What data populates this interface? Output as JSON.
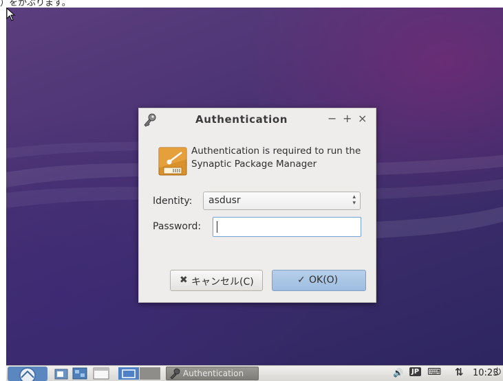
{
  "top_strip": {
    "text": "）をかぶります。"
  },
  "dialog": {
    "title": "Authentication",
    "window_buttons": {
      "minimize": "−",
      "maximize": "+",
      "close": "×"
    },
    "message": "Authentication is required to run the Synaptic Package Manager",
    "identity": {
      "label": "Identity:",
      "value": "asdusr"
    },
    "password": {
      "label": "Password:",
      "value": ""
    },
    "cancel_button": {
      "icon": "✖",
      "label": "キャンセル(C)"
    },
    "ok_button": {
      "icon": "✓",
      "label": "OK(O)"
    }
  },
  "taskbar": {
    "menu_icon": "lubuntu-menu-icon",
    "launchers": [
      "file-manager-icon",
      "desktop-switch-icon",
      "window-icon",
      "workspace-1",
      "workspace-2"
    ],
    "task": {
      "label": "Authentication",
      "icon": "key-icon"
    },
    "tray": {
      "volume": "🔊",
      "input_method": "JP",
      "keyboard": "⌨",
      "network": "⇅",
      "power": "⏻"
    },
    "clock": "10:23"
  },
  "colors": {
    "ok_button": "#a9c6e6",
    "taskbar_task": "#8b8985",
    "desktop": "#4b3373"
  }
}
